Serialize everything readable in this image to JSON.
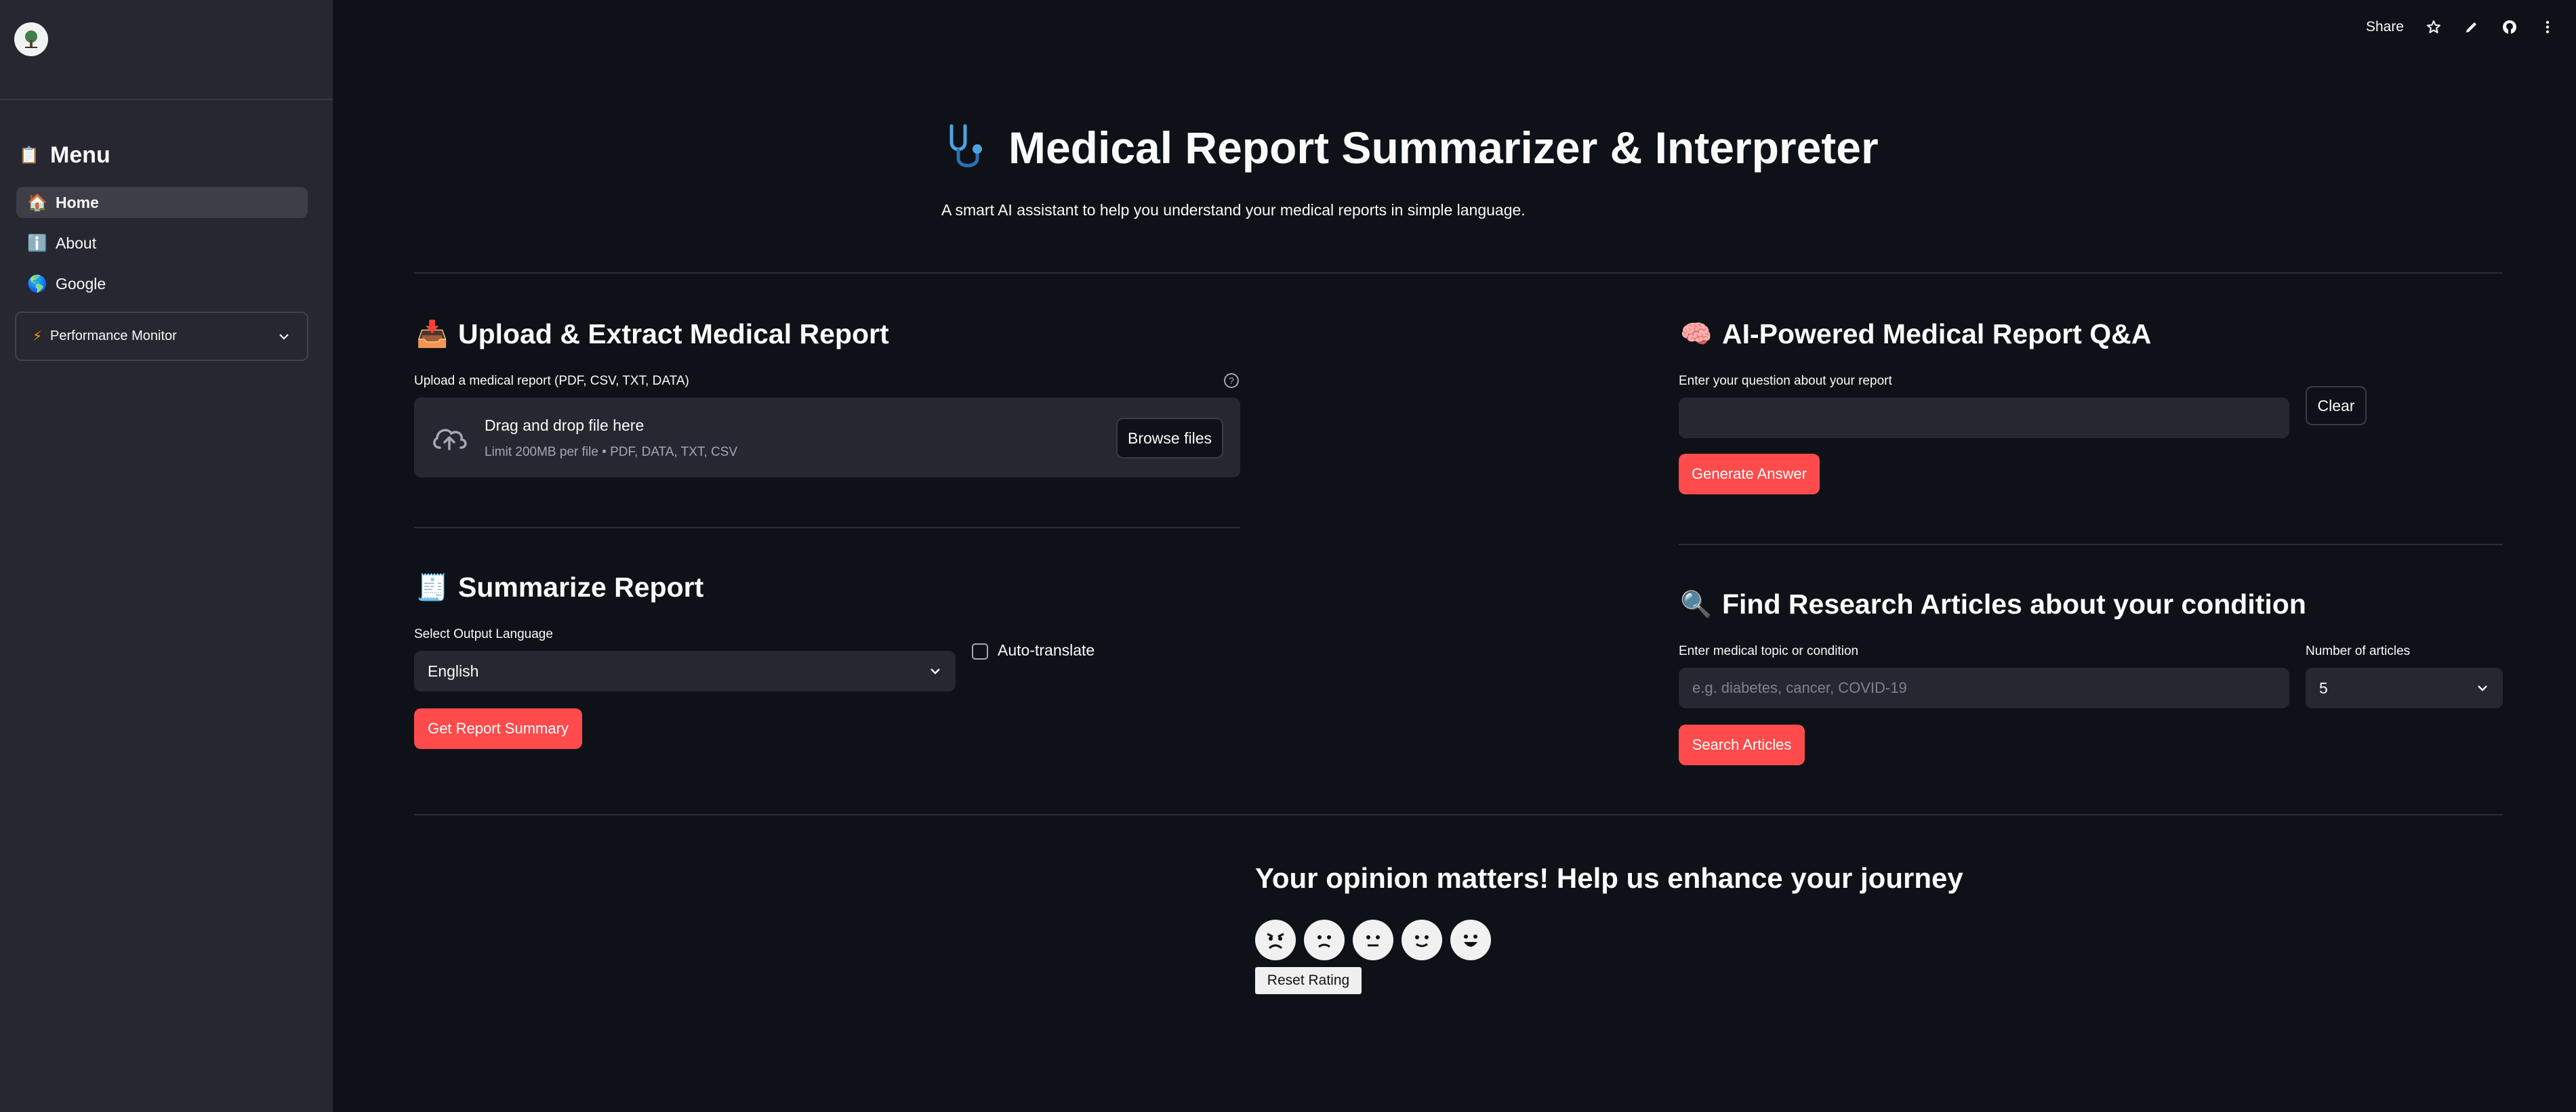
{
  "sidebar": {
    "menu_title": "Menu",
    "items": [
      {
        "label": "Home",
        "icon": "home-icon",
        "active": true
      },
      {
        "label": "About",
        "icon": "info-icon",
        "active": false
      },
      {
        "label": "Google",
        "icon": "globe-icon",
        "active": false
      }
    ],
    "performance_monitor": "Performance Monitor"
  },
  "toolbar": {
    "share_label": "Share"
  },
  "header": {
    "title": "Medical Report Summarizer & Interpreter",
    "subtitle": "A smart AI assistant to help you understand your medical reports in simple language."
  },
  "upload": {
    "title": "Upload & Extract Medical Report",
    "label": "Upload a medical report (PDF, CSV, TXT, DATA)",
    "drop_text": "Drag and drop file here",
    "limit_text": "Limit 200MB per file • PDF, DATA, TXT, CSV",
    "browse_label": "Browse files"
  },
  "summarize": {
    "title": "Summarize Report",
    "language_label": "Select Output Language",
    "language_value": "English",
    "auto_translate_label": "Auto-translate",
    "button_label": "Get Report Summary"
  },
  "qa": {
    "title": "AI-Powered Medical Report Q&A",
    "question_label": "Enter your question about your report",
    "question_value": "",
    "clear_label": "Clear",
    "generate_label": "Generate Answer"
  },
  "research": {
    "title": "Find Research Articles about your condition",
    "topic_label": "Enter medical topic or condition",
    "topic_placeholder": "e.g. diabetes, cancer, COVID-19",
    "count_label": "Number of articles",
    "count_value": "5",
    "search_label": "Search Articles"
  },
  "feedback": {
    "title": "Your opinion matters! Help us enhance your journey",
    "reset_label": "Reset Rating",
    "faces": [
      "angry-face-icon",
      "sad-face-icon",
      "neutral-face-icon",
      "slight-smile-icon",
      "grin-face-icon"
    ]
  },
  "colors": {
    "background": "#0e1117",
    "sidebar": "#262730",
    "primary": "#ff4b4b"
  }
}
